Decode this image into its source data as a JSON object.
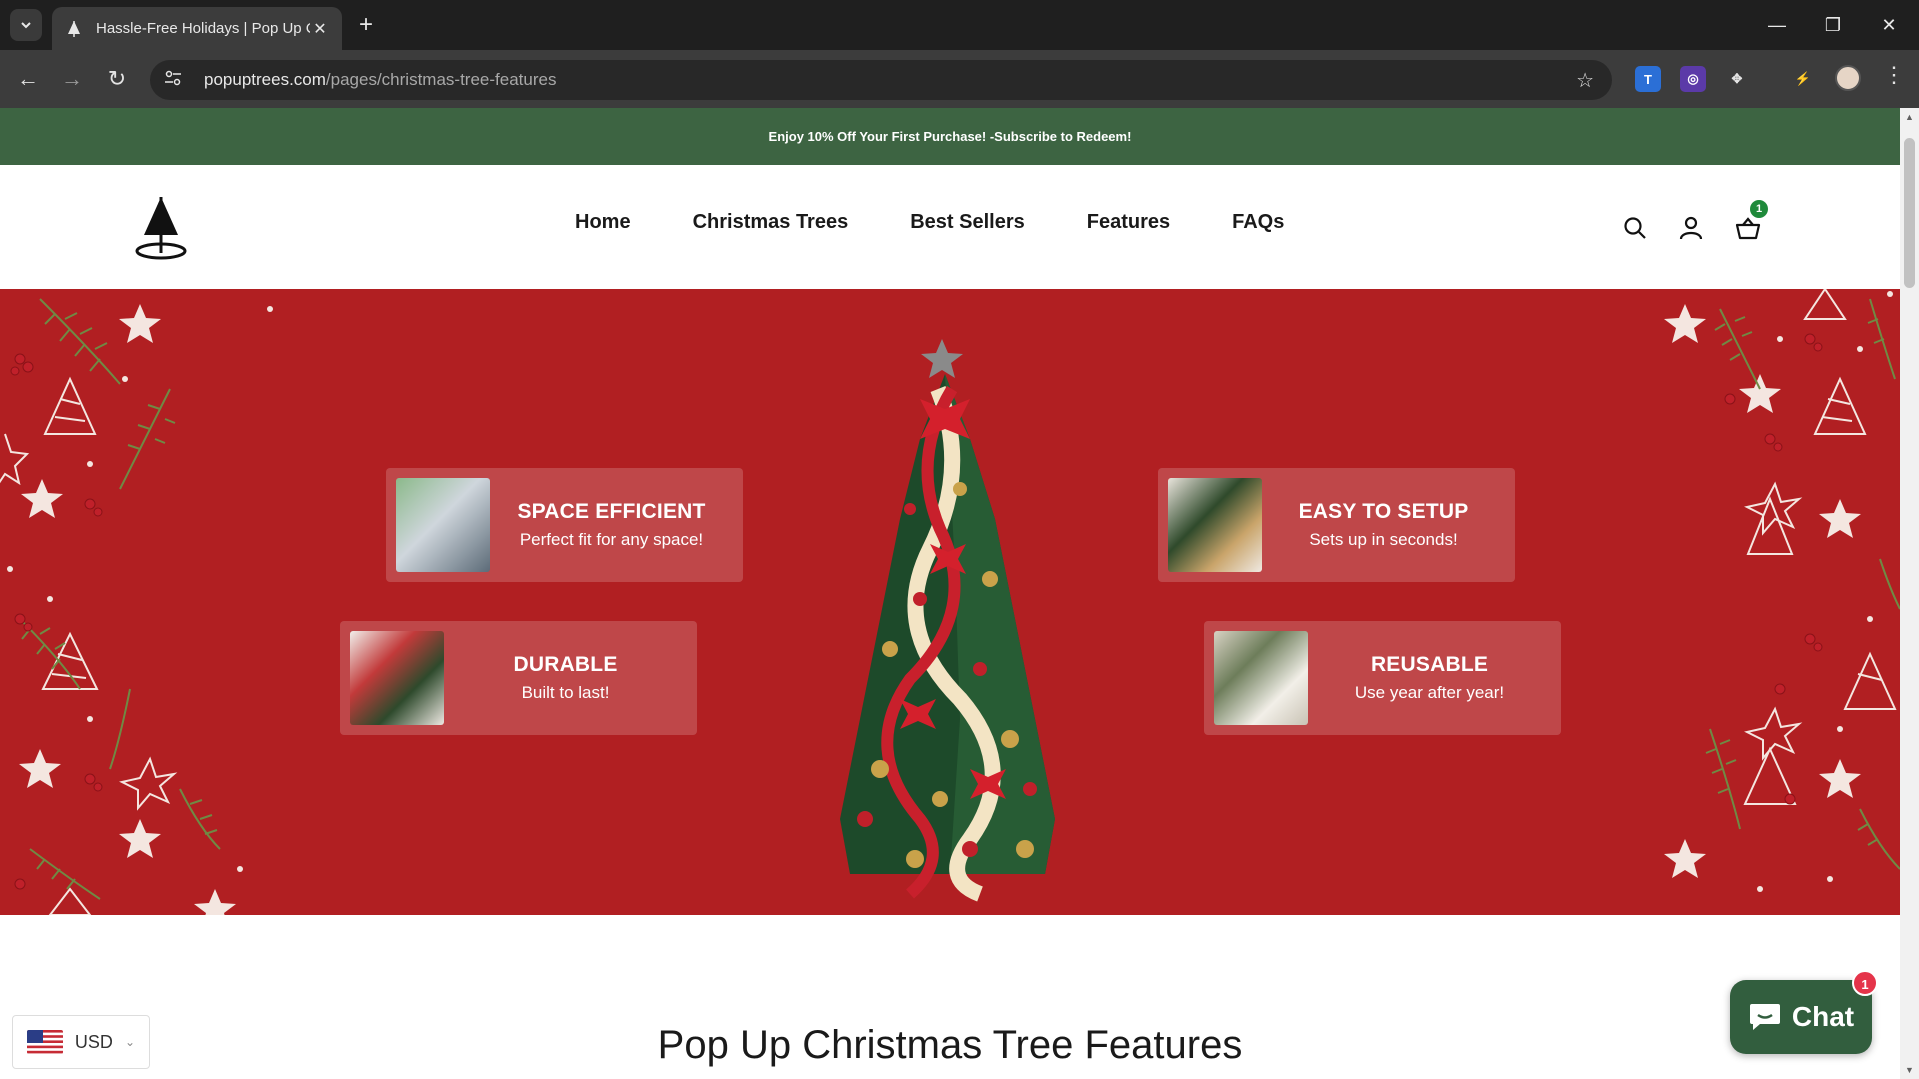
{
  "browser": {
    "tab_title": "Hassle-Free Holidays | Pop Up C",
    "url_host": "popuptrees.com",
    "url_path": "/pages/christmas-tree-features"
  },
  "announcement": "Enjoy 10% Off Your First Purchase! -Subscribe to Redeem!",
  "nav": {
    "items": [
      "Home",
      "Christmas Trees",
      "Best Sellers",
      "Features",
      "FAQs"
    ]
  },
  "cart": {
    "count": "1"
  },
  "features": [
    {
      "title": "SPACE EFFICIENT",
      "subtitle": "Perfect fit for any space!"
    },
    {
      "title": "EASY TO SETUP",
      "subtitle": "Sets up in seconds!"
    },
    {
      "title": "DURABLE",
      "subtitle": "Built to last!"
    },
    {
      "title": "REUSABLE",
      "subtitle": "Use year after year!"
    }
  ],
  "section_title": "Pop Up Christmas Tree Features",
  "currency": {
    "code": "USD"
  },
  "chat": {
    "label": "Chat",
    "badge": "1"
  },
  "colors": {
    "announcement_bg": "#3d6442",
    "hero_bg": "#b11f22",
    "chat_bg": "#325e3e",
    "cart_badge": "#1f8a3b"
  }
}
